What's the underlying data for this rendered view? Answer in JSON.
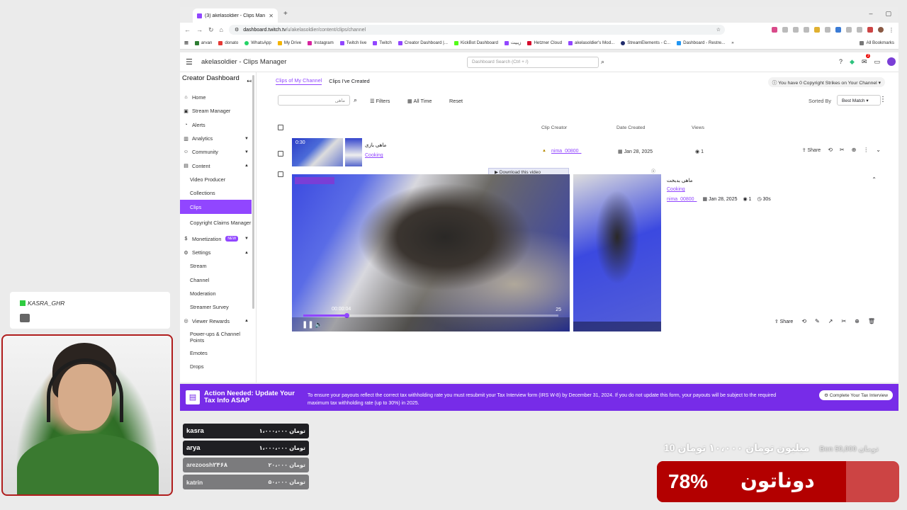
{
  "browser": {
    "tab_title": "(3) akelasoldier - Clips Man",
    "url_host": "dashboard.twitch.tv",
    "url_path": "/u/akelasoldier/content/clips/channel",
    "bookmarks": [
      "arvan",
      "donato",
      "WhatsApp",
      "My Drive",
      "Instagram",
      "Twitch live",
      "Twitch",
      "Creator Dashboard |...",
      "KickBot Dashboard",
      "زیبیت",
      "Hetzner Cloud",
      "akelasoldier's Mod...",
      "StreamElements - C...",
      "Dashboard - Restre..."
    ],
    "all_bookmarks": "All Bookmarks"
  },
  "dashboard": {
    "page_title": "akelasoldier - Clips Manager",
    "search_placeholder": "Dashboard Search (Ctrl + /)",
    "notification_count": "3"
  },
  "sidebar": {
    "heading": "Creator Dashboard",
    "items": [
      {
        "label": "Home",
        "icon": "home-icon"
      },
      {
        "label": "Stream Manager",
        "icon": "stream-icon"
      },
      {
        "label": "Alerts",
        "icon": "alert-icon"
      },
      {
        "label": "Analytics",
        "icon": "analytics-icon"
      },
      {
        "label": "Community",
        "icon": "community-icon"
      },
      {
        "label": "Content",
        "icon": "content-icon"
      },
      {
        "label": "Video Producer"
      },
      {
        "label": "Collections"
      },
      {
        "label": "Clips"
      },
      {
        "label": "Copyright Claims Manager"
      },
      {
        "label": "Monetization",
        "icon": "money-icon",
        "badge": "NEW"
      },
      {
        "label": "Settings",
        "icon": "settings-icon"
      },
      {
        "label": "Stream"
      },
      {
        "label": "Channel"
      },
      {
        "label": "Moderation"
      },
      {
        "label": "Streamer Survey"
      },
      {
        "label": "Viewer Rewards",
        "icon": "rewards-icon"
      },
      {
        "label": "Power-ups & Channel Points"
      },
      {
        "label": "Emotes"
      },
      {
        "label": "Drops"
      }
    ]
  },
  "clips": {
    "tab_my_channel": "Clips of My Channel",
    "tab_created": "Clips I've Created",
    "strikes_text": "You have 0 Copyright Strikes on Your Channel",
    "search_value": "ماهی",
    "filters_label": "Filters",
    "time_label": "All Time",
    "reset_label": "Reset",
    "sorted_by_label": "Sorted By",
    "sort_value": "Best Match",
    "col_creator": "Clip Creator",
    "col_date": "Date Created",
    "col_views": "Views",
    "row1": {
      "duration": "0:30",
      "title": "ماهی بازی",
      "category": "Cooking",
      "creator": "nima_00800_",
      "date": "Jan 28, 2025",
      "views": "1",
      "share": "Share"
    },
    "row2": {
      "title": "ماهی بدبخت",
      "category": "Cooking",
      "creator": "nima_00800_",
      "date": "Jan 28, 2025",
      "views": "1",
      "length": "30s",
      "share": "Share",
      "download_badge": "Download this video",
      "player_time": "00:00:04",
      "player_overlay_number": "25",
      "progress": 0.17
    }
  },
  "tax_banner": {
    "heading": "Action Needed: Update Your Tax Info ASAP",
    "text": "To ensure your payouts reflect the correct tax withholding rate you must resubmit your Tax Interview form (IRS W-8) by December 31, 2024. If you do not update this form, your payouts will be subject to the required maximum tax withholding rate (up to 30%) in 2025.",
    "button": "Complete Your Tax Interview"
  },
  "chat": {
    "username": "KASRA_GHR"
  },
  "donors": [
    {
      "name": "kasra",
      "amount": "۱،۰۰۰،۰۰۰ تومان"
    },
    {
      "name": "arya",
      "amount": "۱،۰۰۰،۰۰۰ تومان"
    },
    {
      "name": "arezoosh۲۴۶۸",
      "amount": "۲۰،۰۰۰ تومان"
    },
    {
      "name": "katrin",
      "amount": "۵۰،۰۰۰ تومان"
    }
  ],
  "goal": {
    "headline": "10 میلیون تومان  ۱۰،۰۰۰ تومان",
    "last_donation": "Ben 50,000 تومان",
    "percent_text": "78%",
    "percent": 0.78,
    "label": "دوناتون"
  }
}
